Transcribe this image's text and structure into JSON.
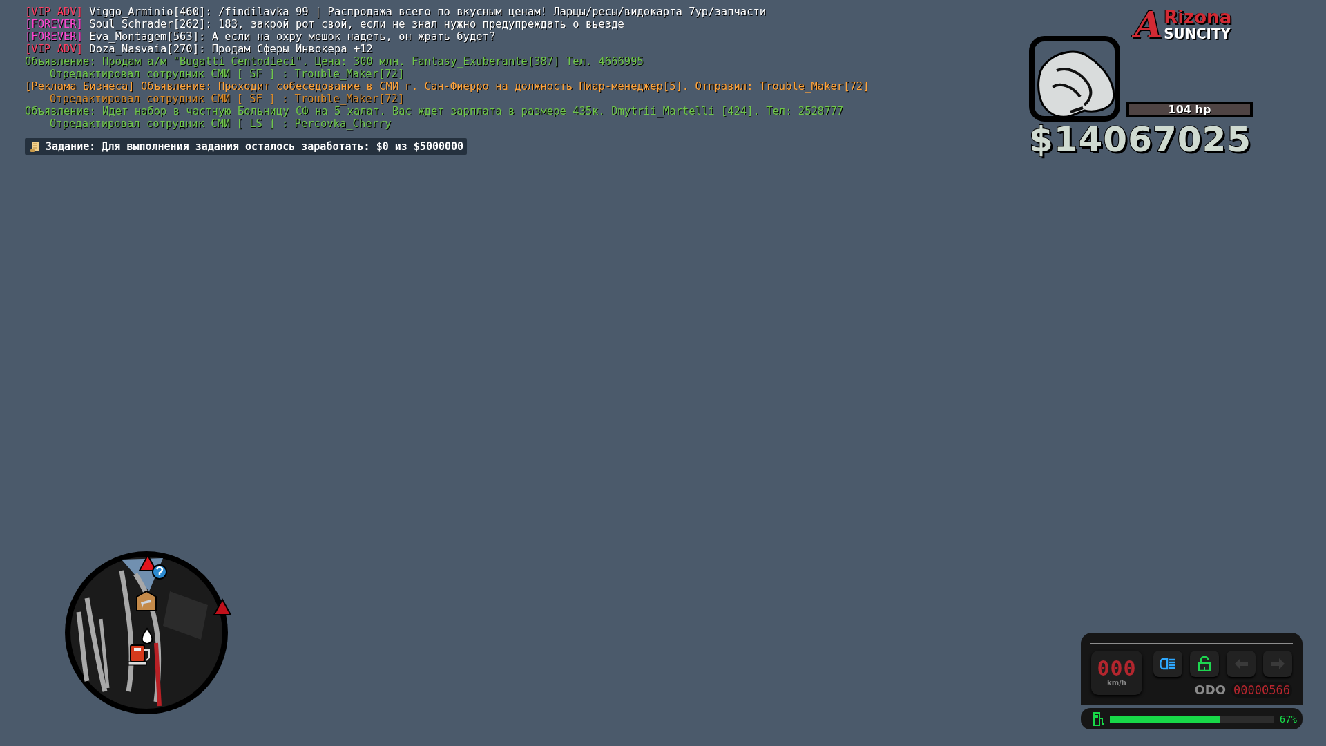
{
  "chat": {
    "lines": [
      {
        "kind": "message",
        "segments": [
          {
            "text": "[VIP ADV]",
            "kind": "vip"
          },
          {
            "text": " Viggo_Arminio[460]: /findilavka 99 | Распродажа всего по вкусным ценам! Ларцы/ресы/видокарта 7ур/запчасти",
            "kind": "white"
          }
        ]
      },
      {
        "kind": "message",
        "segments": [
          {
            "text": "[FOREVER]",
            "kind": "forever"
          },
          {
            "text": " Soul_Schrader[262]: 183, закрой рот свой, если не знал нужно предупреждать о вьезде",
            "kind": "white"
          }
        ]
      },
      {
        "kind": "message",
        "segments": [
          {
            "text": "[FOREVER]",
            "kind": "forever"
          },
          {
            "text": " Eva_Montagem[563]: А если на охру мешок надеть, он жрать будет?",
            "kind": "white"
          }
        ]
      },
      {
        "kind": "message",
        "segments": [
          {
            "text": "[VIP ADV]",
            "kind": "vip"
          },
          {
            "text": " Doza_Nasvaia[270]: Продам Сферы Инвокера +12",
            "kind": "white"
          }
        ]
      },
      {
        "kind": "message",
        "segments": [
          {
            "text": "Объявление: Продам а/м \"Bugatti Centodieci\". Цена: 300 млн. Fantasy_Exuberante[387] Тел. 4666995",
            "kind": "green"
          }
        ]
      },
      {
        "kind": "note",
        "segments": [
          {
            "text": "Отредактировал сотрудник СМИ [ SF ] : Trouble_Maker[72]",
            "kind": "green"
          }
        ]
      },
      {
        "kind": "message",
        "segments": [
          {
            "text": "[Реклама Бизнеса] Объявление: Проходит собеседование в СМИ г. Сан-Фиерро на должность Пиар-менеджер[5]. Отправил: Trouble_Maker[72]",
            "kind": "orange"
          }
        ]
      },
      {
        "kind": "note",
        "segments": [
          {
            "text": "Отредактировал сотрудник СМИ [ SF ] : Trouble_Maker[72]",
            "kind": "dim-orange"
          }
        ]
      },
      {
        "kind": "message",
        "segments": [
          {
            "text": "Объявление: Идет набор в частную Больницу СФ на 5 халат. Вас ждет зарплата в размере 435к. Dmytrii_Martelli [424]. Тел: 2528777",
            "kind": "green"
          }
        ]
      },
      {
        "kind": "note",
        "segments": [
          {
            "text": "Отредактировал сотрудник СМИ [ LS ] : Percovka_Cherry",
            "kind": "green"
          }
        ]
      }
    ]
  },
  "task": {
    "text": "Задание: Для выполнения задания осталось заработать: $0 из $5000000"
  },
  "hud": {
    "logo": {
      "initial": "A",
      "word": "Rizona",
      "subtitle": "SUNCITY"
    },
    "health": {
      "text": "104 hp",
      "level": 1
    },
    "money": "$14067025"
  },
  "speedometer": {
    "speed": "000",
    "unit": "km/h",
    "indicators": [
      {
        "kind": "headlight",
        "on": true
      },
      {
        "kind": "lock",
        "on": true
      },
      {
        "kind": "turn-left",
        "on": false
      },
      {
        "kind": "turn-right",
        "on": false
      }
    ],
    "odometer": {
      "label": "ODO",
      "value": "00000566"
    },
    "fuel": {
      "level": 0.67,
      "text": "67%"
    }
  }
}
